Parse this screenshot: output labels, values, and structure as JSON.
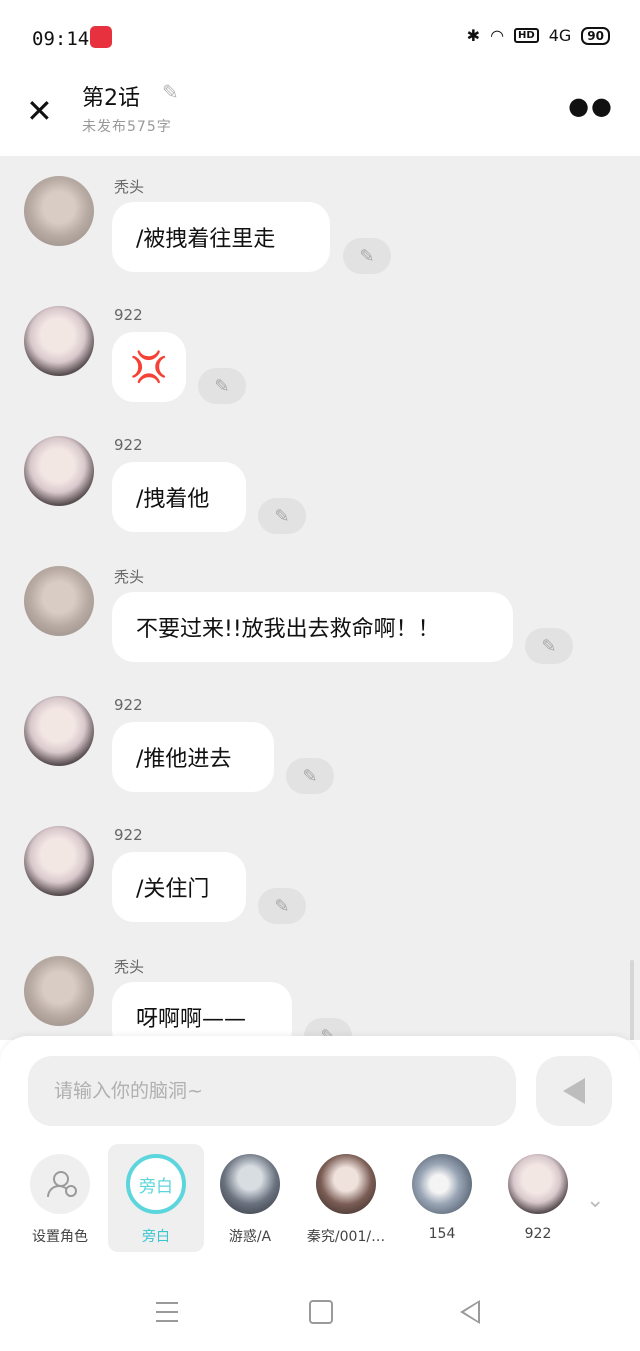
{
  "status_bar": {
    "time": "09:14",
    "battery": "90",
    "network": "4G",
    "hd": "HD"
  },
  "header": {
    "title": "第2话",
    "subtitle": "未发布575字"
  },
  "messages": [
    {
      "name": "秃头",
      "text": "/被拽着往里走",
      "avatar": "bald-avatar"
    },
    {
      "name": "922",
      "text": "💢",
      "avatar": "922-avatar"
    },
    {
      "name": "922",
      "text": "/拽着他",
      "avatar": "922-avatar"
    },
    {
      "name": "秃头",
      "text": "不要过来!!放我出去救命啊！！",
      "avatar": "bald-avatar"
    },
    {
      "name": "922",
      "text": "/推他进去",
      "avatar": "922-avatar"
    },
    {
      "name": "922",
      "text": "/关住门",
      "avatar": "922-avatar"
    },
    {
      "name": "秃头",
      "text": "呀啊啊——",
      "avatar": "bald-avatar"
    }
  ],
  "composer": {
    "placeholder": "请输入你的脑洞~"
  },
  "roles": [
    {
      "label": "设置角色"
    },
    {
      "label": "旁白",
      "avatar_text": "旁白",
      "active": true
    },
    {
      "label": "游惑/A"
    },
    {
      "label": "秦究/001/…"
    },
    {
      "label": "154"
    },
    {
      "label": "922"
    }
  ],
  "colors": {
    "accent": "#5cd6dc",
    "chat_bg": "#efefef",
    "bubble": "#ffffff"
  }
}
